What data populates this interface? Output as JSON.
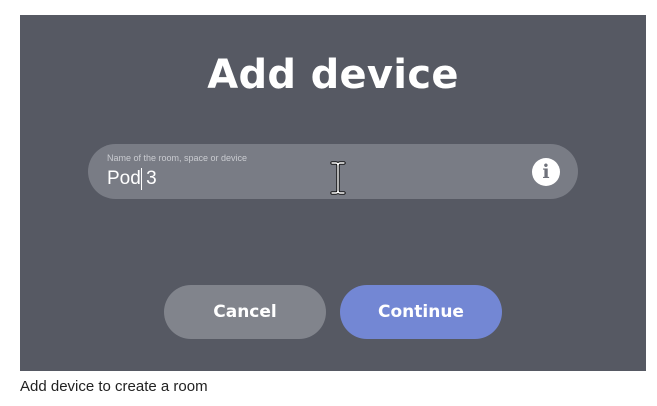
{
  "dialog": {
    "title": "Add device",
    "field": {
      "label": "Name of the room, space or device",
      "value": "Pod 3",
      "info_icon": "info-icon"
    },
    "buttons": {
      "cancel_label": "Cancel",
      "continue_label": "Continue"
    }
  },
  "caption": "Add device to create a room",
  "colors": {
    "background": "#565963",
    "field": "#797c85",
    "cancel": "#81848c",
    "continue": "#7387d4"
  }
}
